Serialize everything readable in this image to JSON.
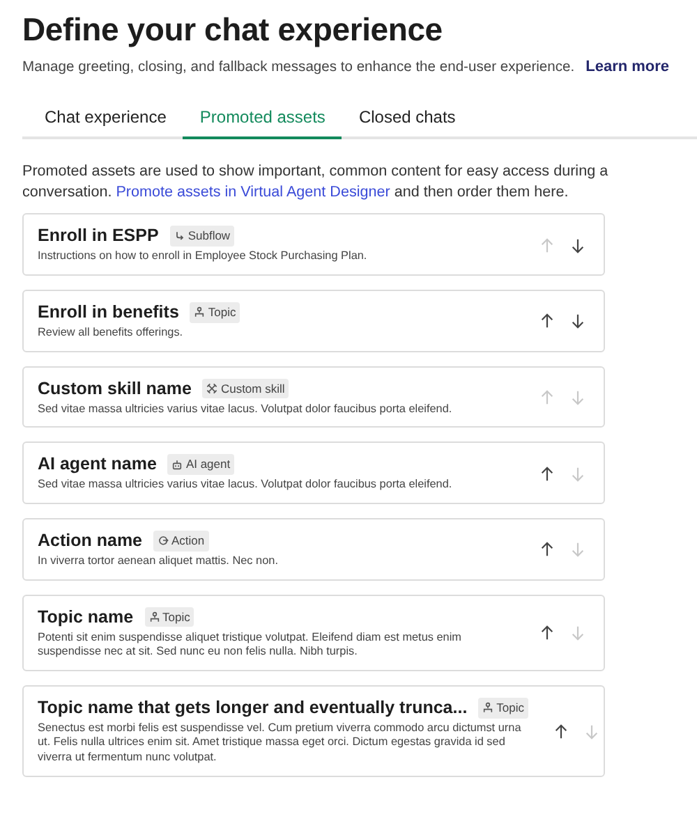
{
  "header": {
    "title": "Define your chat experience",
    "subtitle": "Manage greeting, closing, and fallback messages to enhance the end-user experience.",
    "link": "Learn more"
  },
  "tabs": [
    {
      "label": "Chat experience",
      "selected": false
    },
    {
      "label": "Promoted assets",
      "selected": true
    },
    {
      "label": "Closed chats",
      "selected": false
    }
  ],
  "intro": {
    "text": "Promoted assets are used to show important, common content for easy access during a conversation.",
    "link": "Promote assets in Virtual Agent Designer",
    "after": "and then order them here."
  },
  "assets": [
    {
      "name": "Enroll in ESPP",
      "kind": "subflow",
      "tag": "Subflow",
      "description": "Instructions on how to enroll in Employee Stock Purchasing Plan.",
      "up_disabled": true,
      "down_disabled": false
    },
    {
      "name": "Enroll in benefits",
      "kind": "topic",
      "tag": "Topic",
      "description": "Review all benefits offerings.",
      "up_disabled": false,
      "down_disabled": false
    },
    {
      "name": "Custom skill name",
      "kind": "skill",
      "tag": "Custom skill",
      "description": "Sed vitae massa ultricies varius vitae lacus. Volutpat dolor faucibus porta eleifend.",
      "up_disabled": true,
      "down_disabled": true
    },
    {
      "name": "AI agent name",
      "kind": "agent",
      "tag": "AI agent",
      "description": "Sed vitae massa ultricies varius vitae lacus. Volutpat dolor faucibus porta eleifend.",
      "up_disabled": false,
      "down_disabled": true
    },
    {
      "name": "Action name",
      "kind": "action",
      "tag": "Action",
      "description": "In viverra tortor aenean aliquet mattis. Nec non.",
      "up_disabled": false,
      "down_disabled": true
    },
    {
      "name": "Topic name",
      "kind": "topic",
      "tag": "Topic",
      "description": "Potenti sit enim suspendisse aliquet tristique volutpat. Eleifend diam est metus enim suspendisse nec at sit. Sed nunc eu non felis nulla. Nibh turpis.",
      "up_disabled": false,
      "down_disabled": true
    },
    {
      "name": "Topic name that gets longer and eventually trunca...",
      "kind": "topic",
      "tag": "Topic",
      "description": "Senectus est morbi felis est suspendisse vel. Cum pretium viverra commodo arcu dictumst urna ut. Felis nulla ultrices enim sit. Amet tristique massa eget orci. Dictum egestas gravida id sed viverra ut fermentum nunc volutpat.",
      "up_disabled": false,
      "down_disabled": true
    }
  ]
}
